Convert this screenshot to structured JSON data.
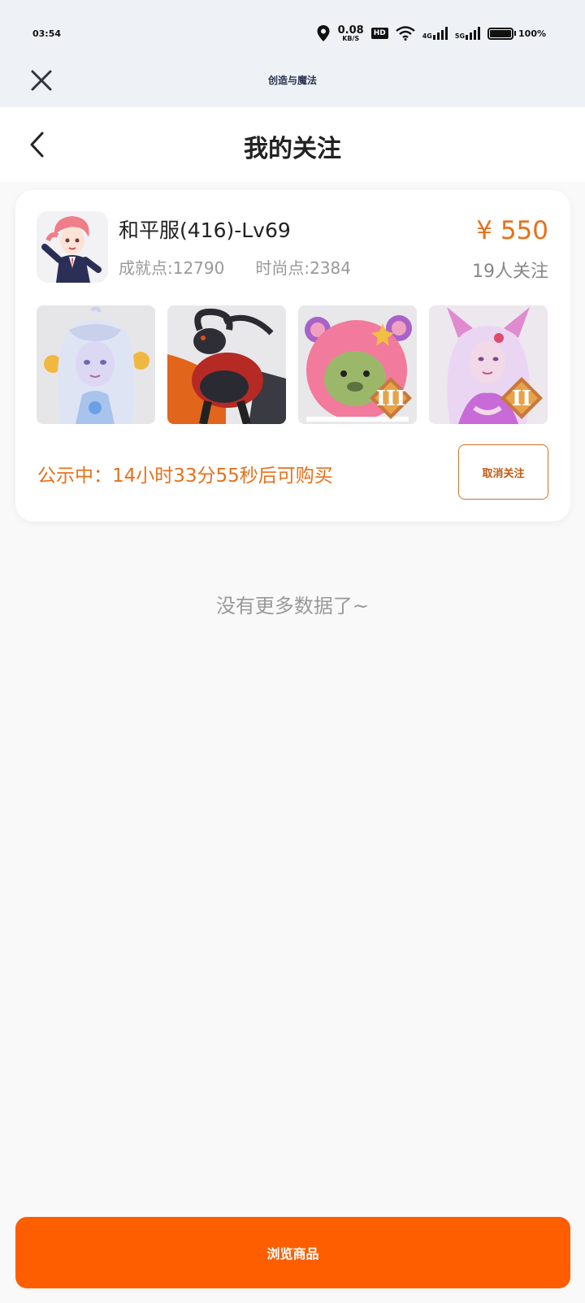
{
  "status_bar": {
    "time": "03:54",
    "speed_value": "0.08",
    "speed_unit": "KB/S",
    "hd_label": "HD",
    "net_4g": "4G",
    "net_5g": "5G",
    "battery": "100%"
  },
  "miniprogram": {
    "title": "创造与魔法"
  },
  "page": {
    "title": "我的关注"
  },
  "card": {
    "account_name": "和平服(416)-Lv69",
    "achievement": "成就点:12790",
    "fashion": "时尚点:2384",
    "price": "¥ 550",
    "followers": "19人关注",
    "thumb_badges": [
      "",
      "",
      "III",
      "II"
    ],
    "notice": "公示中：14小时33分55秒后可购买",
    "unfollow_label": "取消关注"
  },
  "list": {
    "end_text": "没有更多数据了~"
  },
  "footer": {
    "browse_label": "浏览商品"
  },
  "colors": {
    "accent": "#ff5e00",
    "price": "#e8701a"
  }
}
